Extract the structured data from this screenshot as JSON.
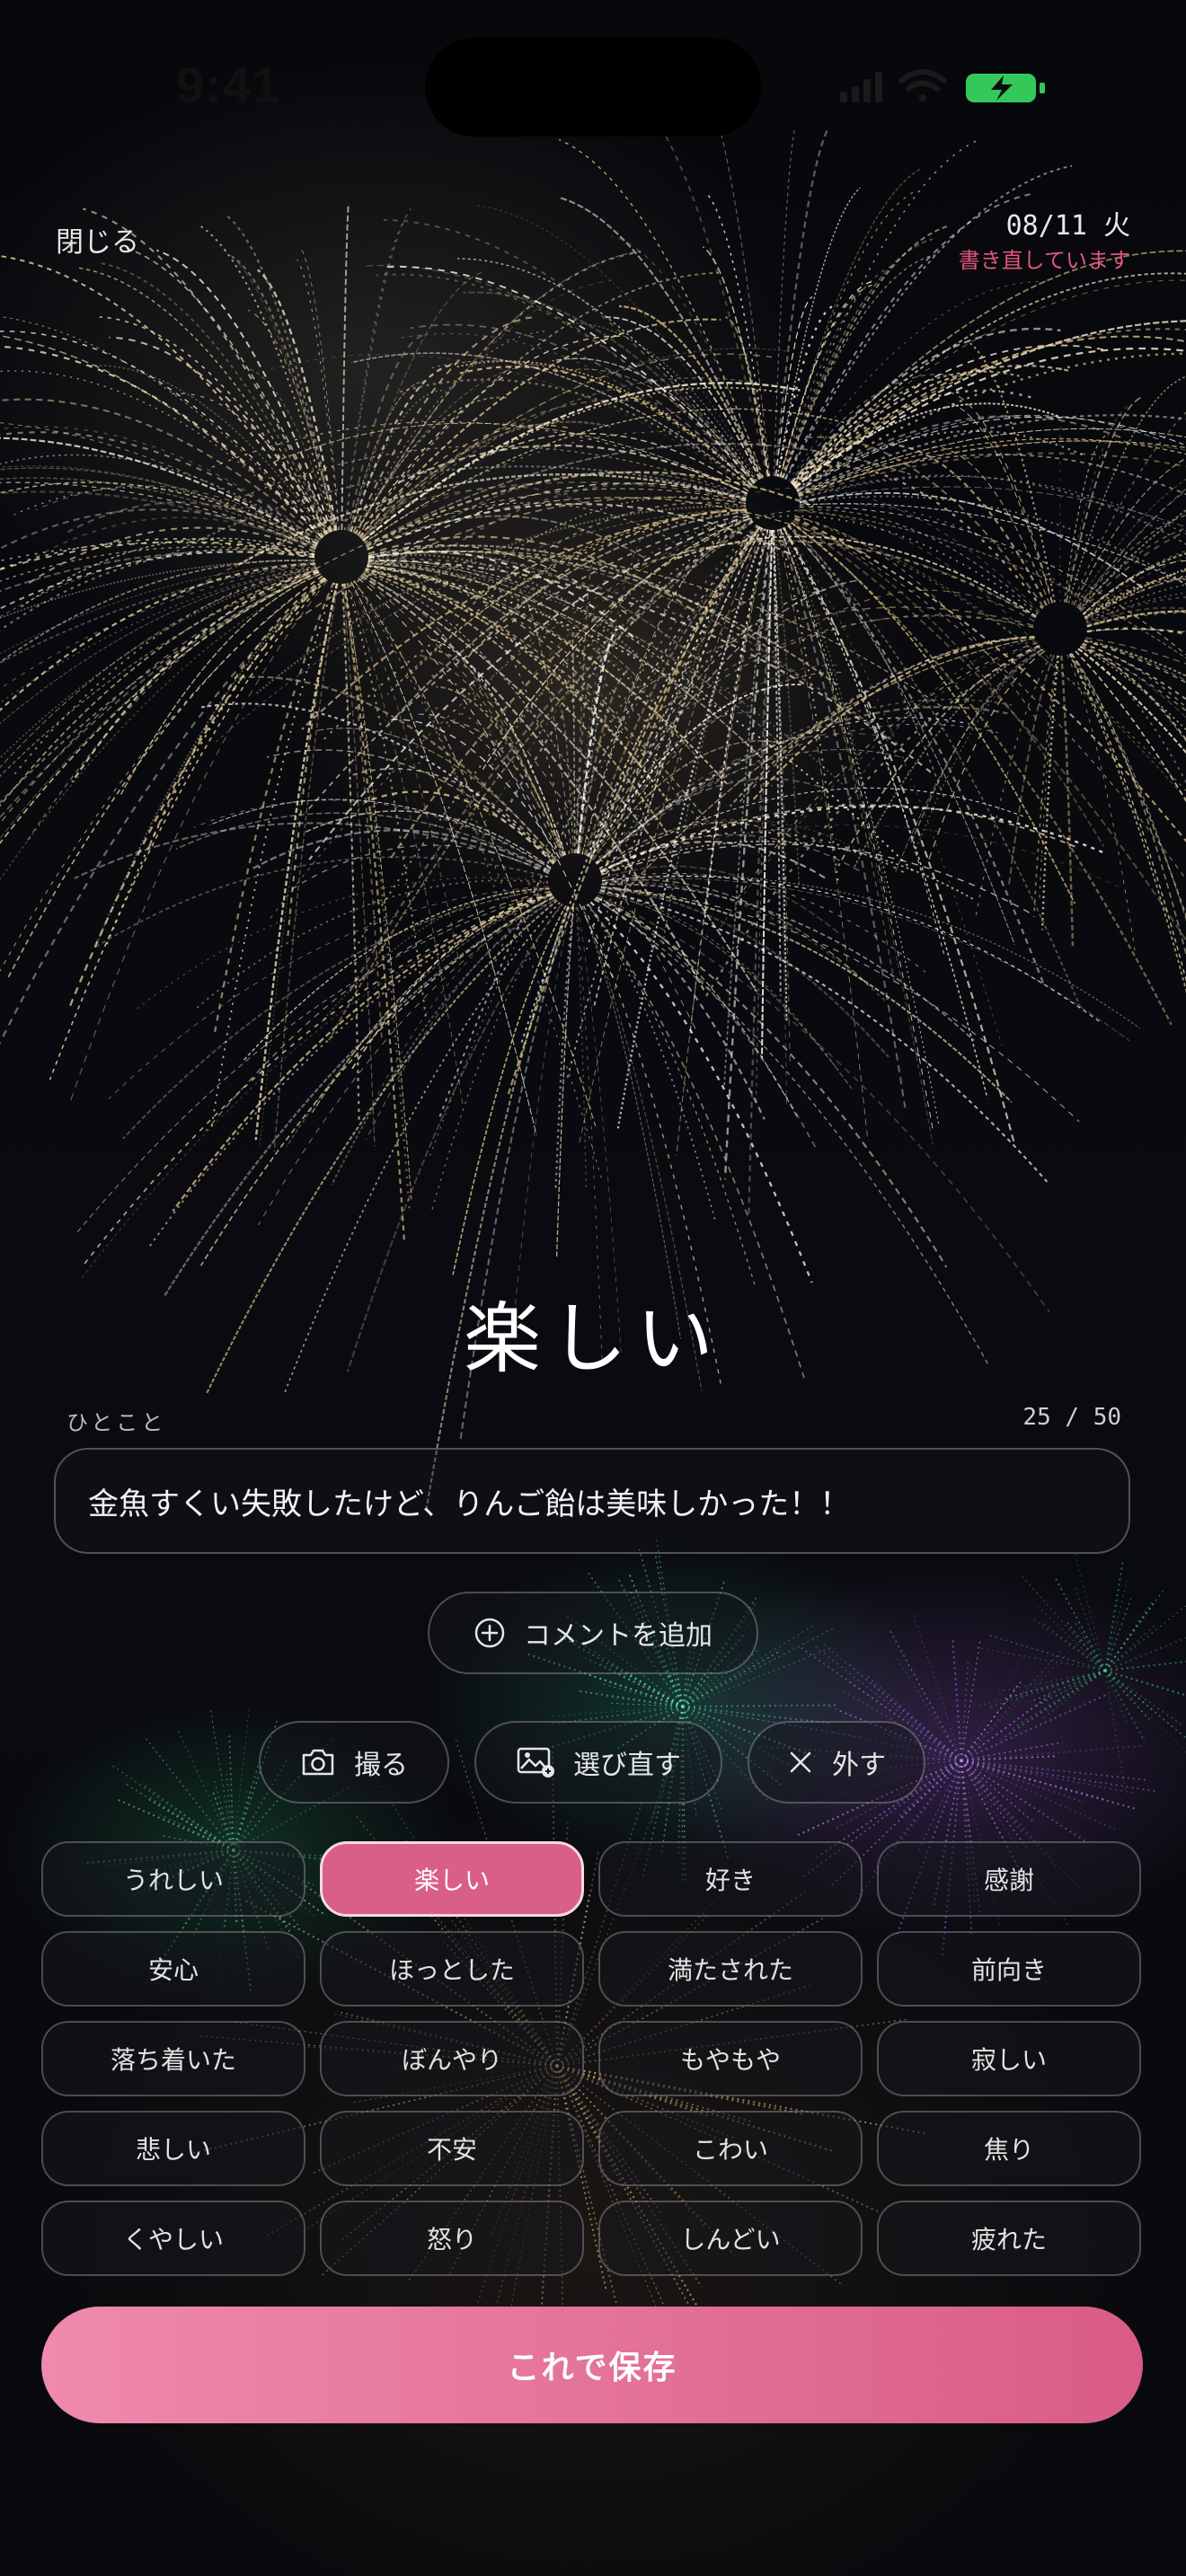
{
  "status_bar": {
    "time": "9:41"
  },
  "header": {
    "close_label": "閉じる",
    "date": "08/11 火",
    "status_note": "書き直しています"
  },
  "mood": {
    "title": "楽しい"
  },
  "comment_field": {
    "label": "ひとこと",
    "count": "25 / 50",
    "value": "金魚すくい失敗したけど、りんご飴は美味しかった！！"
  },
  "actions": {
    "add_comment": "コメントを追加",
    "take_photo": "撮る",
    "reselect_photo": "選び直す",
    "remove_photo": "外す"
  },
  "emotions": [
    {
      "label": "うれしい",
      "selected": false
    },
    {
      "label": "楽しい",
      "selected": true
    },
    {
      "label": "好き",
      "selected": false
    },
    {
      "label": "感謝",
      "selected": false
    },
    {
      "label": "安心",
      "selected": false
    },
    {
      "label": "ほっとした",
      "selected": false
    },
    {
      "label": "満たされた",
      "selected": false
    },
    {
      "label": "前向き",
      "selected": false
    },
    {
      "label": "落ち着いた",
      "selected": false
    },
    {
      "label": "ぼんやり",
      "selected": false
    },
    {
      "label": "もやもや",
      "selected": false
    },
    {
      "label": "寂しい",
      "selected": false
    },
    {
      "label": "悲しい",
      "selected": false
    },
    {
      "label": "不安",
      "selected": false
    },
    {
      "label": "こわい",
      "selected": false
    },
    {
      "label": "焦り",
      "selected": false
    },
    {
      "label": "くやしい",
      "selected": false
    },
    {
      "label": "怒り",
      "selected": false
    },
    {
      "label": "しんどい",
      "selected": false
    },
    {
      "label": "疲れた",
      "selected": false
    }
  ],
  "save_button": {
    "label": "これで保存"
  },
  "colors": {
    "accent": "#d95f88",
    "accent_light": "#ef8aad",
    "note": "#e0577e",
    "battery": "#34c759"
  },
  "background": {
    "description_icon": "fireworks-photo"
  }
}
